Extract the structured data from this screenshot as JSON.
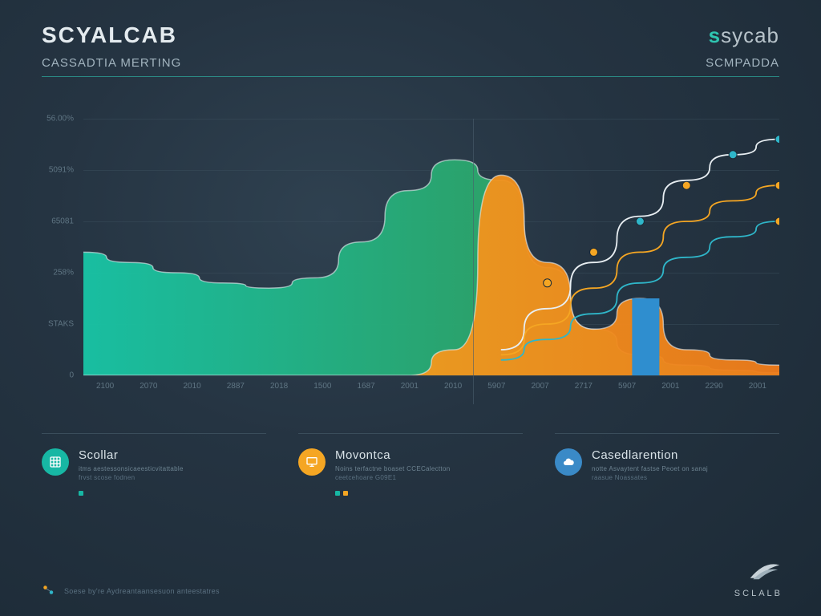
{
  "header": {
    "title_left": "SCYALCAB",
    "brand_s": "s",
    "brand_rest": "sycab",
    "subtitle_left": "CASSADTIA MERTING",
    "subtitle_right": "SCMPADDA"
  },
  "chart_data": {
    "type": "area",
    "x_ticks": [
      "2100",
      "2070",
      "2010",
      "2887",
      "2018",
      "1500",
      "1687",
      "2001",
      "2010",
      "5907",
      "2007",
      "2717",
      "5907",
      "2001",
      "2290",
      "2001"
    ],
    "y_ticks_labels": [
      "0",
      "STAKS",
      "258%",
      "65081",
      "5091%",
      "56.00%"
    ],
    "ylim": [
      0,
      100
    ],
    "grid": true,
    "series": [
      {
        "name": "Scollar",
        "type": "area",
        "color_from": "#18c5a6",
        "color_to": "#2aa86f",
        "values": [
          48,
          44,
          40,
          36,
          34,
          38,
          52,
          72,
          84,
          76,
          42,
          18,
          8,
          4,
          2,
          1
        ]
      },
      {
        "name": "Movontca",
        "type": "area",
        "color_from": "#f7b21e",
        "color_to": "#f07c1a",
        "values": [
          0,
          0,
          0,
          0,
          0,
          0,
          0,
          0,
          10,
          78,
          44,
          18,
          30,
          10,
          6,
          4
        ]
      },
      {
        "name": "Casedlarention-a",
        "type": "line",
        "color": "#e8eef2",
        "values": [
          null,
          null,
          null,
          null,
          null,
          null,
          null,
          null,
          null,
          10,
          26,
          44,
          62,
          76,
          86,
          92
        ]
      },
      {
        "name": "Casedlarention-b",
        "type": "line",
        "color": "#f5a623",
        "values": [
          null,
          null,
          null,
          null,
          null,
          null,
          null,
          null,
          null,
          8,
          20,
          34,
          48,
          60,
          68,
          74
        ]
      },
      {
        "name": "Casedlarention-c",
        "type": "line",
        "color": "#2fb6c9",
        "values": [
          null,
          null,
          null,
          null,
          null,
          null,
          null,
          null,
          null,
          6,
          14,
          24,
          36,
          46,
          54,
          60
        ]
      }
    ],
    "markers": [
      {
        "x": 10,
        "y": 36,
        "color": "#f5a623"
      },
      {
        "x": 11,
        "y": 48,
        "color": "#f5a623"
      },
      {
        "x": 12,
        "y": 60,
        "color": "#2fb6c9"
      },
      {
        "x": 13,
        "y": 74,
        "color": "#f5a623"
      },
      {
        "x": 14,
        "y": 86,
        "color": "#2fb6c9"
      },
      {
        "x": 15,
        "y": 92,
        "color": "#2fb6c9"
      },
      {
        "x": 15,
        "y": 74,
        "color": "#f5a623"
      },
      {
        "x": 15,
        "y": 60,
        "color": "#f5a623"
      }
    ]
  },
  "info": [
    {
      "icon": "grid",
      "color": "teal",
      "heading": "Scollar",
      "sub1": "itms aestessonsicaeesticvitattable",
      "sub2": "frvst scose fodnen",
      "legend": [
        "teal"
      ]
    },
    {
      "icon": "monitor",
      "color": "orange",
      "heading": "Movontca",
      "sub1": "Noins terfactne boaset CCECalectton",
      "sub2": "ceetcehoare G09E1",
      "legend": [
        "teal",
        "orange"
      ]
    },
    {
      "icon": "cloud",
      "color": "blue",
      "heading": "Casedlarention",
      "sub1": "notte Asvaytent fastse Peoet on sanaj",
      "sub2": "raasue Noassates",
      "legend": []
    }
  ],
  "footer": {
    "text": "Soese by're Aydreantaansesuon anteestatres"
  },
  "brand": {
    "label": "SCLALB"
  }
}
